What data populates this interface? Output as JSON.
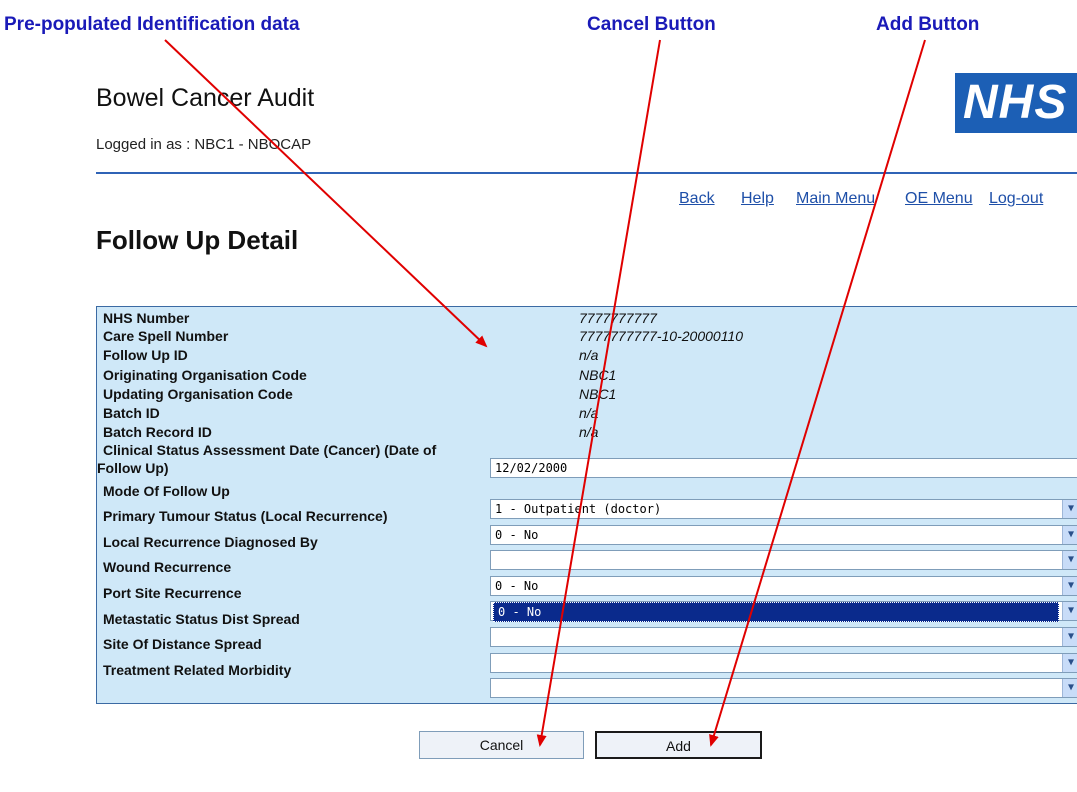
{
  "callouts": {
    "prepopulated": "Pre-populated Identification data",
    "cancel": "Cancel Button",
    "add": "Add Button"
  },
  "header": {
    "title": "Bowel Cancer Audit",
    "logged_in": "Logged in as : NBC1 - NBOCAP",
    "logo": "NHS"
  },
  "nav": {
    "back": "Back",
    "help": "Help",
    "main_menu": "Main Menu",
    "oe_menu": "OE Menu",
    "logout": "Log-out"
  },
  "page_title": "Follow Up Detail",
  "identification": [
    {
      "label": "NHS Number",
      "value": "7777777777"
    },
    {
      "label": "Care Spell Number",
      "value": "7777777777-10-20000110"
    },
    {
      "label": "Follow Up ID",
      "value": "n/a"
    },
    {
      "label": "Originating Organisation Code",
      "value": "NBC1"
    },
    {
      "label": "Updating Organisation Code",
      "value": "NBC1"
    },
    {
      "label": "Batch ID",
      "value": "n/a"
    },
    {
      "label": "Batch Record ID",
      "value": "n/a"
    }
  ],
  "assessment_date": {
    "label_line1": "Clinical Status Assessment Date (Cancer) (Date of",
    "label_line2": "Follow Up)",
    "value": "12/02/2000"
  },
  "fields": [
    {
      "label": "Mode Of Follow Up",
      "value": "1 - Outpatient (doctor)"
    },
    {
      "label": "Primary Tumour Status (Local Recurrence)",
      "value": "0 - No"
    },
    {
      "label": "Local Recurrence Diagnosed By",
      "value": ""
    },
    {
      "label": "Wound Recurrence",
      "value": "0 - No"
    },
    {
      "label": "Port Site Recurrence",
      "value": "0 - No"
    },
    {
      "label": "Metastatic Status Dist Spread",
      "value": ""
    },
    {
      "label": "Site Of Distance Spread",
      "value": ""
    },
    {
      "label": "Treatment Related Morbidity",
      "value": ""
    }
  ],
  "buttons": {
    "cancel": "Cancel",
    "add": "Add"
  },
  "colors": {
    "callout_text": "#1a1ab8",
    "arrow": "#e00000",
    "panel_bg": "#cfe8f8",
    "link": "#1e4fa8",
    "nhs_blue": "#1c5fb5"
  },
  "icons": {
    "dropdown": "chevron-down-icon"
  }
}
